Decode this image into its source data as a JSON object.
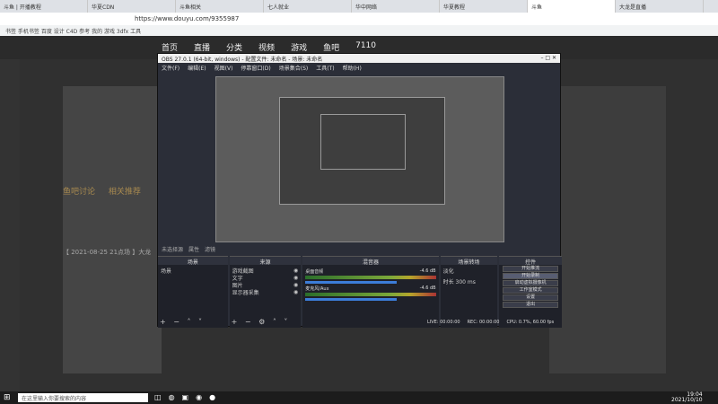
{
  "browser": {
    "tabs": [
      "斗鱼 | 开播教程",
      "华夏CDN",
      "斗鱼相关",
      "七人就业",
      "华中网络",
      "华夏教程",
      "斗鱼",
      "大龙是直播"
    ],
    "url": "https://www.douyu.com/9355987"
  },
  "bookmarks": "书签  手机书签  百度  设计  C4D  参考  我的  游戏  3dfx  工具",
  "douyu": {
    "nav": [
      "首页",
      "直播",
      "分类",
      "视频",
      "游戏",
      "鱼吧",
      "7110"
    ],
    "tabs": [
      "鱼吧讨论",
      "相关推荐"
    ],
    "chat_line": "【 2021-08-25 21点场 】大龙"
  },
  "obs": {
    "title": "OBS 27.0.1 (64-bit, windows) - 配置文件: 未命名 - 场景: 未命名",
    "menu": [
      "文件(F)",
      "编辑(E)",
      "视图(V)",
      "停靠窗口(D)",
      "场景集合(S)",
      "工具(T)",
      "帮助(H)"
    ],
    "status_left": "未选择源",
    "status_props": "属性",
    "status_filters": "滤镜",
    "docks": {
      "scenes": {
        "header": "场景",
        "item": "场景"
      },
      "sources": {
        "header": "来源",
        "items": [
          "游戏截图",
          "文字",
          "图片",
          "显示器采集"
        ]
      },
      "mixer": {
        "header": "混音器",
        "tracks": [
          {
            "name": "桌面音频",
            "level": "-4.6 dB"
          },
          {
            "name": "麦克风/Aux",
            "level": "-4.6 dB"
          }
        ]
      },
      "transitions": {
        "header": "场景转场",
        "type": "淡化",
        "duration_label": "时长",
        "duration": "300 ms"
      },
      "controls": {
        "header": "控件",
        "buttons": [
          "开始推流",
          "开始录制",
          "启动虚拟摄像机",
          "工作室模式",
          "设置",
          "退出"
        ]
      }
    },
    "footer": [
      "LIVE: 00:00:00",
      "REC: 00:00:00",
      "CPU: 0.7%, 60.00 fps"
    ]
  },
  "taskbar": {
    "search_placeholder": "在这里输入你要搜索的内容",
    "time": "19:04",
    "date": "2021/10/10"
  }
}
